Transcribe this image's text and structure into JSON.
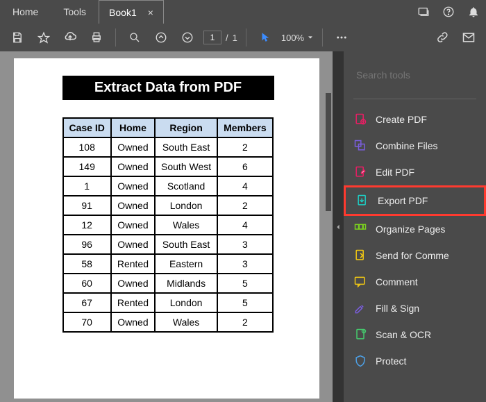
{
  "tabs": {
    "home": "Home",
    "tools": "Tools",
    "doc": "Book1",
    "close": "×"
  },
  "page_nav": {
    "current": "1",
    "sep": "/",
    "total": "1"
  },
  "zoom": "100%",
  "paper": {
    "title": "Extract Data from PDF",
    "headers": [
      "Case ID",
      "Home",
      "Region",
      "Members"
    ],
    "rows": [
      [
        "108",
        "Owned",
        "South East",
        "2"
      ],
      [
        "149",
        "Owned",
        "South West",
        "6"
      ],
      [
        "1",
        "Owned",
        "Scotland",
        "4"
      ],
      [
        "91",
        "Owned",
        "London",
        "2"
      ],
      [
        "12",
        "Owned",
        "Wales",
        "4"
      ],
      [
        "96",
        "Owned",
        "South East",
        "3"
      ],
      [
        "58",
        "Rented",
        "Eastern",
        "3"
      ],
      [
        "60",
        "Owned",
        "Midlands",
        "5"
      ],
      [
        "67",
        "Rented",
        "London",
        "5"
      ],
      [
        "70",
        "Owned",
        "Wales",
        "2"
      ]
    ]
  },
  "sidebar": {
    "search_placeholder": "Search tools",
    "items": [
      {
        "label": "Create PDF",
        "color": "#ec1d64",
        "hl": false
      },
      {
        "label": "Combine Files",
        "color": "#7b5ee0",
        "hl": false
      },
      {
        "label": "Edit PDF",
        "color": "#ec1d64",
        "hl": false
      },
      {
        "label": "Export PDF",
        "color": "#1dd0c6",
        "hl": true
      },
      {
        "label": "Organize Pages",
        "color": "#7bd11e",
        "hl": false
      },
      {
        "label": "Send for Comme",
        "color": "#f3c912",
        "hl": false
      },
      {
        "label": "Comment",
        "color": "#f3c912",
        "hl": false
      },
      {
        "label": "Fill & Sign",
        "color": "#7b5ee0",
        "hl": false
      },
      {
        "label": "Scan & OCR",
        "color": "#45c96d",
        "hl": false
      },
      {
        "label": "Protect",
        "color": "#4da0e6",
        "hl": false
      }
    ]
  },
  "chart_data": {
    "type": "table",
    "title": "Extract Data from PDF",
    "columns": [
      "Case ID",
      "Home",
      "Region",
      "Members"
    ],
    "rows": [
      [
        108,
        "Owned",
        "South East",
        2
      ],
      [
        149,
        "Owned",
        "South West",
        6
      ],
      [
        1,
        "Owned",
        "Scotland",
        4
      ],
      [
        91,
        "Owned",
        "London",
        2
      ],
      [
        12,
        "Owned",
        "Wales",
        4
      ],
      [
        96,
        "Owned",
        "South East",
        3
      ],
      [
        58,
        "Rented",
        "Eastern",
        3
      ],
      [
        60,
        "Owned",
        "Midlands",
        5
      ],
      [
        67,
        "Rented",
        "London",
        5
      ],
      [
        70,
        "Owned",
        "Wales",
        2
      ]
    ]
  }
}
